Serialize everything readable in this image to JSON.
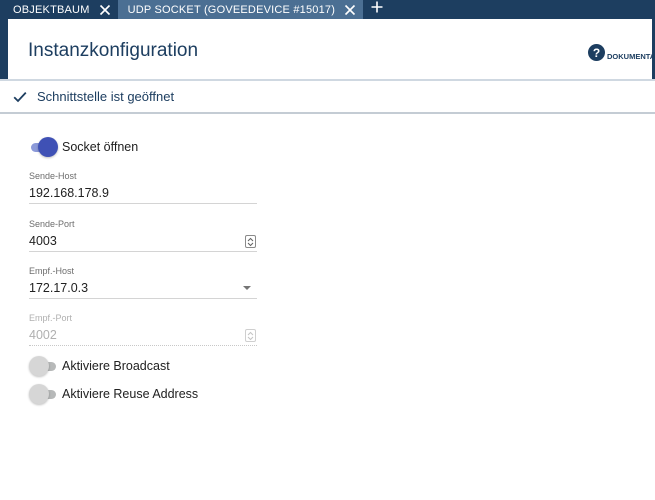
{
  "tabs": [
    {
      "label": "OBJEKTBAUM",
      "active": false
    },
    {
      "label": "UDP SOCKET (GOVEEDEVICE #15017)",
      "active": true
    }
  ],
  "header": {
    "title": "Instanzkonfiguration",
    "doc_label": "DOKUMENTAT",
    "doc_icon": "?"
  },
  "status": {
    "text": "Schnittstelle ist geöffnet"
  },
  "form": {
    "socket_open": {
      "label": "Socket öffnen",
      "checked": true
    },
    "send_host": {
      "label": "Sende-Host",
      "value": "192.168.178.9"
    },
    "send_port": {
      "label": "Sende-Port",
      "value": "4003"
    },
    "recv_host": {
      "label": "Empf.-Host",
      "value": "172.17.0.3"
    },
    "recv_port": {
      "label": "Empf.-Port",
      "value": "4002"
    },
    "broadcast": {
      "label": "Aktiviere Broadcast",
      "checked": false
    },
    "reuse_address": {
      "label": "Aktiviere Reuse Address",
      "checked": false
    }
  },
  "colors": {
    "tabbar": "#1d3e60",
    "active_tab": "#4b6f93",
    "accent": "#3f51b5"
  }
}
